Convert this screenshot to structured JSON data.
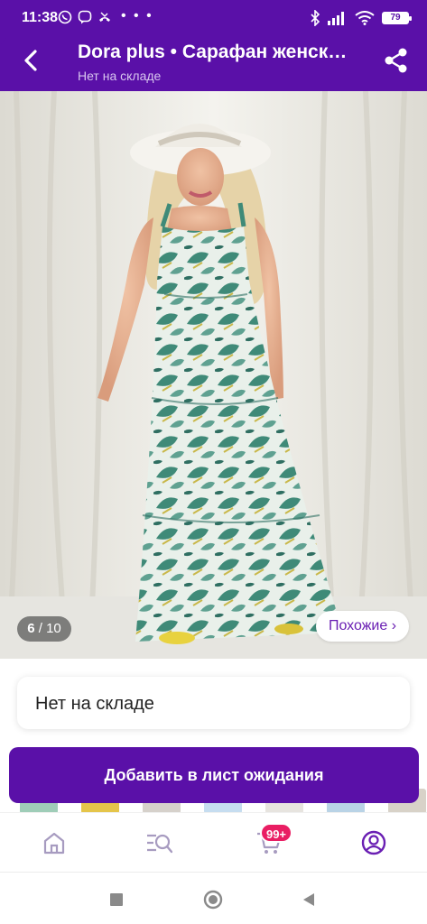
{
  "status_bar": {
    "time": "11:38",
    "battery": "79"
  },
  "header": {
    "title": "Dora plus • Сарафан женск…",
    "subtitle": "Нет на складе"
  },
  "gallery": {
    "counter_current": "6",
    "counter_total": "10",
    "similar_label": "Похожие ›"
  },
  "stock": {
    "label": "Нет на складе"
  },
  "actions": {
    "waitlist_label": "Добавить в лист ожидания"
  },
  "bottom_nav": {
    "cart_badge": "99+",
    "items": [
      "home-icon",
      "catalog-search-icon",
      "cart-icon",
      "profile-icon"
    ]
  },
  "colors": {
    "brand": "#5a10a8",
    "badge": "#e91e63"
  }
}
